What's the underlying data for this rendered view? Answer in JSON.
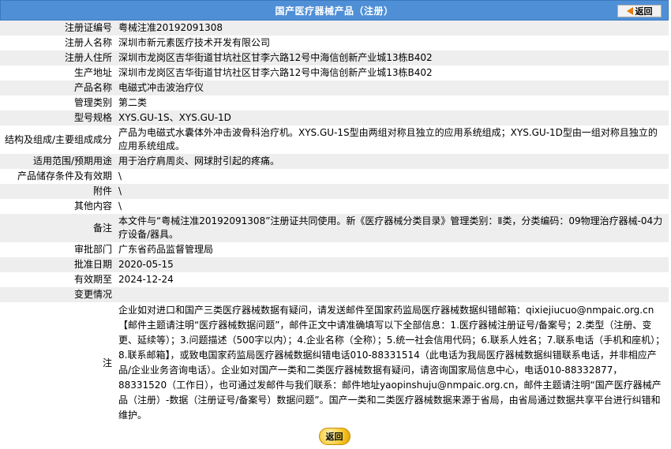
{
  "header": {
    "title": "国产医疗器械产品（注册）",
    "back_label": "返回"
  },
  "rows": [
    {
      "label": "注册证编号",
      "value": "粤械注准20192091308"
    },
    {
      "label": "注册人名称",
      "value": "深圳市新元素医疗技术开发有限公司"
    },
    {
      "label": "注册人住所",
      "value": "深圳市龙岗区吉华街道甘坑社区甘李六路12号中海信创新产业城13栋B402"
    },
    {
      "label": "生产地址",
      "value": "深圳市龙岗区吉华街道甘坑社区甘李六路12号中海信创新产业城13栋B402"
    },
    {
      "label": "产品名称",
      "value": "电磁式冲击波治疗仪"
    },
    {
      "label": "管理类别",
      "value": "第二类"
    },
    {
      "label": "型号规格",
      "value": "XYS.GU-1S、XYS.GU-1D"
    },
    {
      "label": "结构及组成/主要组成成分",
      "value": "产品为电磁式水囊体外冲击波骨科治疗机。XYS.GU-1S型由两组对称且独立的应用系统组成；XYS.GU-1D型由一组对称且独立的应用系统组成。"
    },
    {
      "label": "适用范围/预期用途",
      "value": "用于治疗肩周炎、网球肘引起的疼痛。"
    },
    {
      "label": "产品储存条件及有效期",
      "value": "\\"
    },
    {
      "label": "附件",
      "value": "\\"
    },
    {
      "label": "其他内容",
      "value": "\\"
    },
    {
      "label": "备注",
      "value": "本文件与“粤械注准20192091308”注册证共同使用。新《医疗器械分类目录》管理类别：Ⅱ类，分类编码：09物理治疗器械-04力疗设备/器具。"
    },
    {
      "label": "审批部门",
      "value": "广东省药品监督管理局"
    },
    {
      "label": "批准日期",
      "value": "2020-05-15"
    },
    {
      "label": "有效期至",
      "value": "2024-12-24"
    },
    {
      "label": "变更情况",
      "value": ""
    }
  ],
  "note": {
    "label": "注",
    "text": "企业如对进口和国产三类医疗器械数据有疑问，请发送邮件至国家药监局医疗器械数据纠错邮箱：qixiejiucuo@nmpaic.org.cn【邮件主题请注明“医疗器械数据问题”，邮件正文中请准确填写以下全部信息：1.医疗器械注册证号/备案号；2.类型（注册、变更、延续等）；3.问题描述（500字以内）；4.企业名称（全称）；5.统一社会信用代码；6.联系人姓名；7.联系电话（手机和座机）；8.联系邮箱】，或致电国家药监局医疗器械数据纠错电话010-88331514（此电话为我局医疗器械数据纠错联系电话，并非相应产品/企业业务咨询电话）。企业如对国产一类和二类医疗器械数据有疑问，请咨询国家局信息中心，电话010-88332877，88331520（工作日），也可通过发邮件与我们联系：邮件地址yaopinshuju@nmpaic.org.cn，邮件主题请注明“国产医疗器械产品（注册）-数据（注册证号/备案号）数据问题”。国产一类和二类医疗器械数据来源于省局，由省局通过数据共享平台进行纠错和维护。"
  },
  "footer": {
    "back_label": "返回"
  },
  "colors": {
    "header_bg": "#4f8fd6",
    "row_alt": "#eeeeee",
    "back_button": "#f4c62a"
  }
}
